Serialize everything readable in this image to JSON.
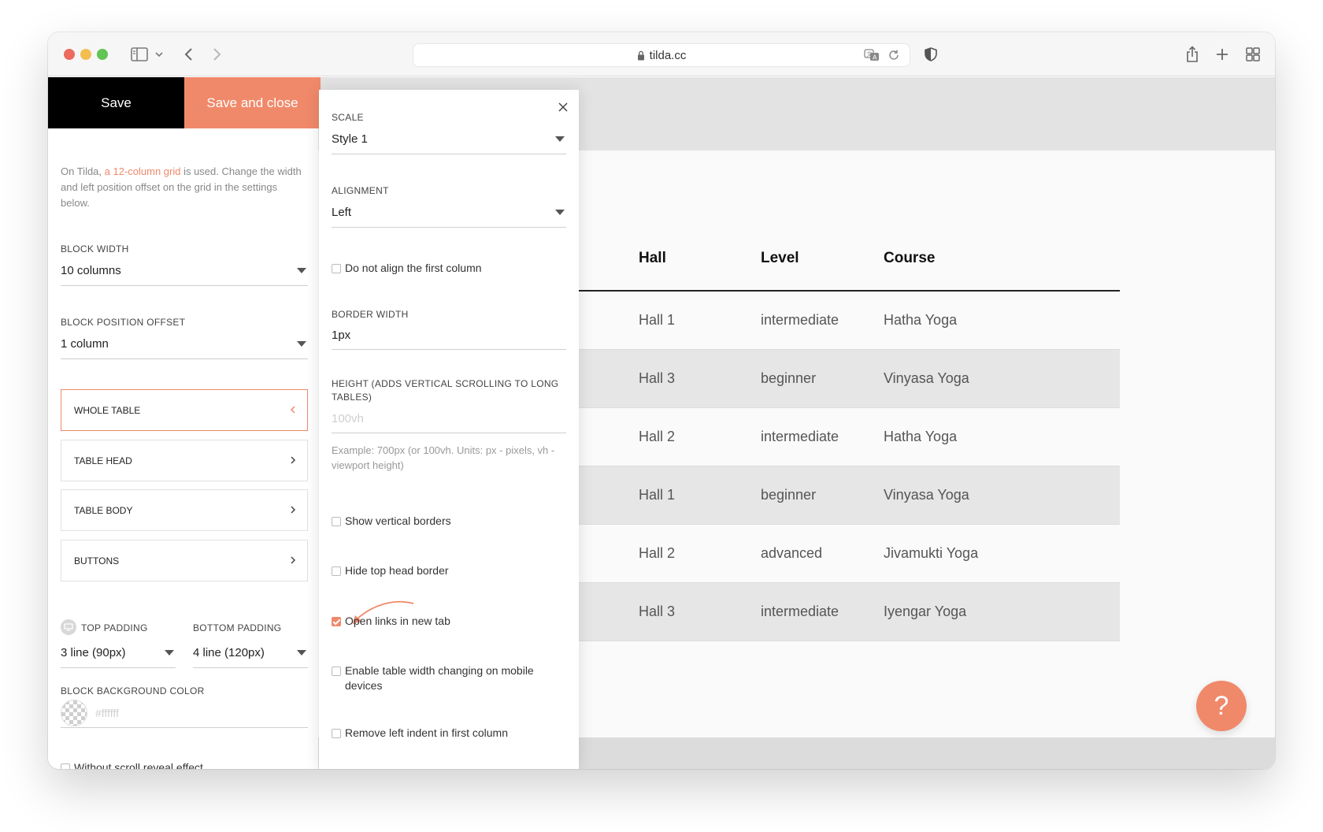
{
  "browser": {
    "url": "tilda.cc"
  },
  "left_panel": {
    "save_label": "Save",
    "save_close_label": "Save and close",
    "intro_before": "On Tilda, ",
    "intro_link": "a 12-column grid",
    "intro_after": " is used. Change the width and left position offset on the grid in the settings below.",
    "block_width_label": "BLOCK WIDTH",
    "block_width_value": "10 columns",
    "block_offset_label": "BLOCK POSITION OFFSET",
    "block_offset_value": "1 column",
    "sections": [
      "WHOLE TABLE",
      "TABLE HEAD",
      "TABLE BODY",
      "BUTTONS"
    ],
    "top_padding_label": "TOP PADDING",
    "top_padding_value": "3 line (90px)",
    "bottom_padding_label": "BOTTOM PADDING",
    "bottom_padding_value": "4 line (120px)",
    "bg_color_label": "BLOCK BACKGROUND COLOR",
    "bg_color_placeholder": "#ffffff",
    "scroll_reveal_label": "Without scroll reveal effect",
    "scroll_reveal_checked": false
  },
  "settings_popup": {
    "scale_label": "SCALE",
    "scale_value": "Style 1",
    "alignment_label": "ALIGNMENT",
    "alignment_value": "Left",
    "no_align_first_label": "Do not align the first column",
    "border_width_label": "BORDER WIDTH",
    "border_width_value": "1px",
    "height_label": "HEIGHT (ADDS VERTICAL SCROLLING TO LONG TABLES)",
    "height_placeholder": "100vh",
    "height_hint": "Example: 700px (or 100vh. Units: px - pixels, vh - viewport height)",
    "show_vertical_borders_label": "Show vertical borders",
    "hide_top_head_border_label": "Hide top head border",
    "open_links_new_tab_label": "Open links in new tab",
    "open_links_new_tab_checked": true,
    "enable_width_mobile_label": "Enable table width changing on mobile devices",
    "remove_left_indent_label": "Remove left indent in first column"
  },
  "table": {
    "headers": [
      "Hall",
      "Level",
      "Course"
    ],
    "rows": [
      [
        "Hall 1",
        "intermediate",
        "Hatha Yoga"
      ],
      [
        "Hall 3",
        "beginner",
        "Vinyasa Yoga"
      ],
      [
        "Hall 2",
        "intermediate",
        "Hatha Yoga"
      ],
      [
        "Hall 1",
        "beginner",
        "Vinyasa Yoga"
      ],
      [
        "Hall 2",
        "advanced",
        "Jivamukti Yoga"
      ],
      [
        "Hall 3",
        "intermediate",
        "Iyengar Yoga"
      ]
    ]
  },
  "help_label": "?",
  "colors": {
    "accent": "#f0896a",
    "save_bg": "#000000"
  }
}
